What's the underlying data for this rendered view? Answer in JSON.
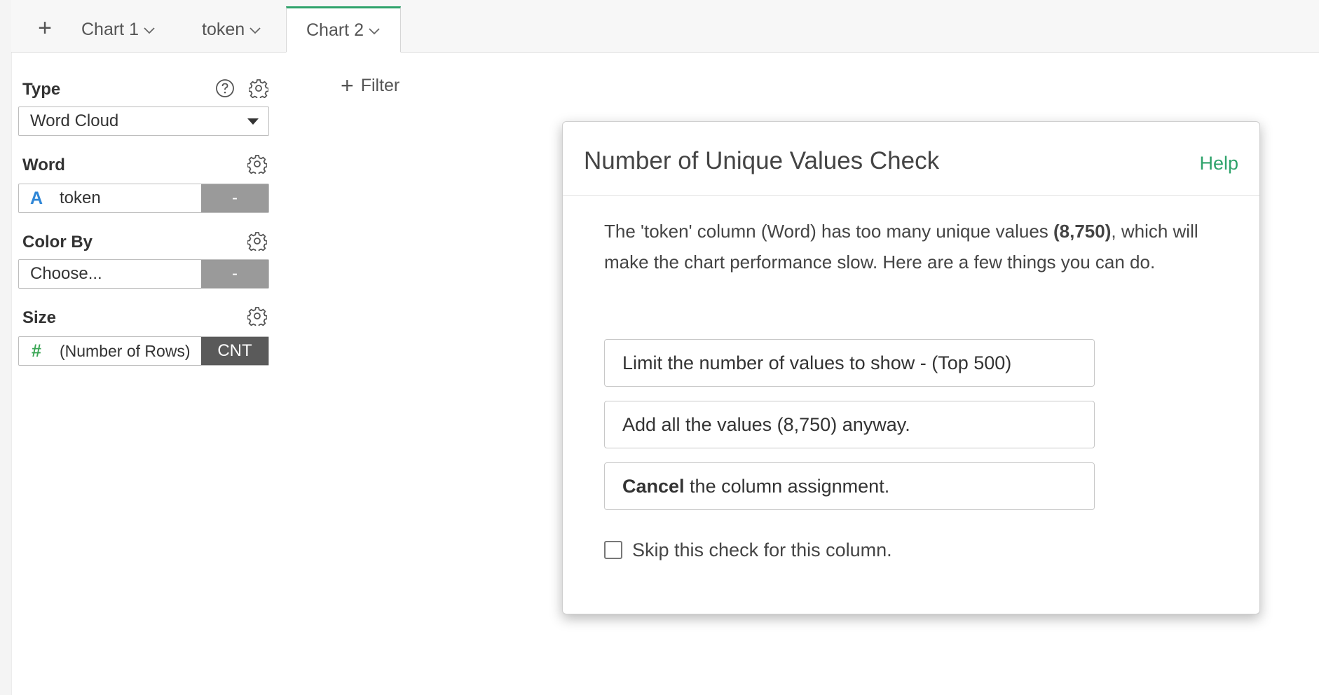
{
  "tabs": {
    "add_label": "+",
    "items": [
      {
        "label": "Chart 1"
      },
      {
        "label": "token"
      },
      {
        "label": "Chart 2"
      }
    ]
  },
  "panel": {
    "type_label": "Type",
    "type_value": "Word Cloud",
    "word_label": "Word",
    "word_column": "token",
    "word_agg": "-",
    "color_label": "Color By",
    "color_placeholder": "Choose...",
    "color_agg": "-",
    "size_label": "Size",
    "size_column": "(Number of Rows)",
    "size_agg": "CNT",
    "text_type_glyph": "A",
    "number_type_glyph": "#"
  },
  "filter": {
    "plus": "+",
    "label": "Filter"
  },
  "dialog": {
    "title": "Number of Unique Values Check",
    "help": "Help",
    "message_pre": "The 'token' column (Word) has too many unique values ",
    "message_bold": "(8,750)",
    "message_post": ", which will make the chart performance slow. Here are a few things you can do.",
    "option_limit": "Limit the number of values to show - (Top 500)",
    "option_add_all": "Add all the values (8,750) anyway.",
    "option_cancel_bold": "Cancel",
    "option_cancel_rest": " the column assignment.",
    "skip_label": "Skip this check for this column."
  },
  "colors": {
    "accent_green": "#2fa36b",
    "text_type_blue": "#2f86d6",
    "number_type_green": "#3aa655"
  }
}
